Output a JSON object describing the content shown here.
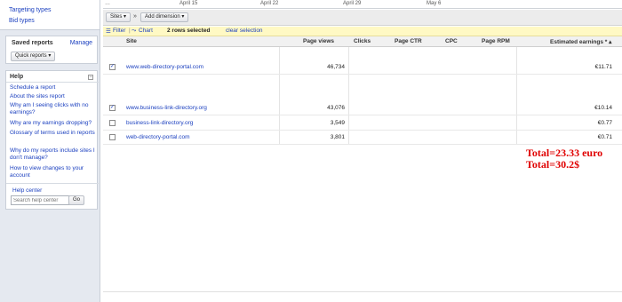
{
  "sidebar": {
    "top_links": [
      "Targeting types",
      "Bid types"
    ],
    "saved_reports": {
      "title": "Saved reports",
      "manage_label": "Manage",
      "quick_reports_label": "Quick reports ▾"
    },
    "help": {
      "title": "Help",
      "collapse_glyph": "−",
      "links": [
        "Schedule a report",
        "About the sites report",
        "Why am I seeing clicks with no earnings?",
        "Why are my earnings dropping?",
        "Glossary of terms used in reports",
        "Why do my reports include sites I don't manage?",
        "How to view changes to your account"
      ],
      "help_center_label": "Help center",
      "search_placeholder": "Search help center",
      "go_label": "Go"
    }
  },
  "main": {
    "date_axis": [
      "April 15",
      "April 22",
      "April 29",
      "May 6"
    ],
    "controls": {
      "sites_label": "Sites ▾",
      "arrow": "»",
      "add_dimension_label": "Add dimension ▾"
    },
    "filter_bar": {
      "filter_label": "Filter",
      "chart_label": "Chart",
      "selected_text": "2 rows selected",
      "clear_label": "clear selection"
    },
    "columns": [
      "Site",
      "Page views",
      "Clicks",
      "Page CTR",
      "CPC",
      "Page RPM",
      "Estimated earnings * ▴"
    ],
    "rows": [
      {
        "site": "www.web-directory-portal.com",
        "page_views": "46,734",
        "earnings": "€11.71",
        "checked": true
      },
      {
        "site": "www.business-link-directory.org",
        "page_views": "43,076",
        "earnings": "€10.14",
        "checked": true
      },
      {
        "site": "business-link-directory.org",
        "page_views": "3,549",
        "earnings": "€0.77",
        "checked": false
      },
      {
        "site": "web-directory-portal.com",
        "page_views": "3,801",
        "earnings": "€0.71",
        "checked": false
      }
    ],
    "check_glyph": "✓",
    "annotation": {
      "line1": "Total=23.33 euro",
      "line2": "Total=30.2$"
    }
  },
  "colors": {
    "link": "#1a3fbf",
    "annotation": "#e00000",
    "filter_bar": "#fff9c4",
    "sidebar_bg": "#e5e9f0"
  }
}
